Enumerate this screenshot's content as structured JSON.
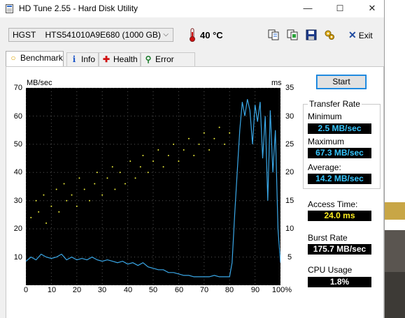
{
  "window": {
    "title": "HD Tune 2.55 - Hard Disk Utility",
    "min_glyph": "—",
    "max_glyph": "☐",
    "close_glyph": "✕"
  },
  "toolbar": {
    "drive": "HGST    HTS541010A9E680 (1000 GB)",
    "temperature": "40 °C",
    "exit_label": "Exit"
  },
  "tabs": [
    {
      "label": "Benchmark",
      "icon": "lightbulb-icon"
    },
    {
      "label": "Info",
      "icon": "info-icon"
    },
    {
      "label": "Health",
      "icon": "health-cross-icon"
    },
    {
      "label": "Error Scan",
      "icon": "magnifier-icon"
    }
  ],
  "chart": {
    "left_unit": "MB/sec",
    "right_unit": "ms",
    "left_ticks": [
      "70",
      "60",
      "50",
      "40",
      "30",
      "20",
      "10"
    ],
    "right_ticks": [
      "35",
      "30",
      "25",
      "20",
      "15",
      "10",
      "5"
    ],
    "x_ticks": [
      "0",
      "10",
      "20",
      "30",
      "40",
      "50",
      "60",
      "70",
      "80",
      "90",
      "100%"
    ]
  },
  "chart_data": {
    "type": "line",
    "xlabel": "",
    "ylabel": "MB/sec",
    "y2label": "ms",
    "xlim": [
      0,
      100
    ],
    "ylim": [
      0,
      70
    ],
    "y2lim": [
      0,
      35
    ],
    "grid": true,
    "series": [
      {
        "axis": "left",
        "color": "#3aa8e8",
        "x": [
          0,
          2,
          4,
          6,
          8,
          10,
          12,
          14,
          16,
          18,
          20,
          22,
          24,
          26,
          28,
          30,
          32,
          34,
          36,
          38,
          40,
          42,
          44,
          46,
          48,
          50,
          52,
          54,
          56,
          58,
          60,
          62,
          64,
          66,
          68,
          70,
          72,
          74,
          76,
          78,
          80,
          81,
          82,
          83,
          84,
          85,
          86,
          87,
          88,
          89,
          90,
          91,
          92,
          93,
          94,
          95,
          96,
          97,
          98,
          99,
          100
        ],
        "y": [
          8.5,
          10,
          9,
          11,
          10,
          9.5,
          10,
          11,
          9,
          10,
          9,
          9.5,
          9,
          10,
          9,
          8.5,
          9,
          8.5,
          8,
          8.5,
          7.5,
          8,
          7,
          8,
          6.5,
          6,
          5.5,
          5.5,
          4.5,
          4.5,
          4,
          3.5,
          3.5,
          3,
          3,
          3,
          3,
          3.5,
          3,
          3,
          3,
          8,
          25,
          40,
          55,
          65,
          60,
          66,
          62,
          50,
          64,
          58,
          65,
          45,
          60,
          30,
          62,
          40,
          55,
          20,
          8
        ]
      },
      {
        "axis": "right",
        "type": "scatter",
        "color": "#e8e83a",
        "x": [
          2,
          4,
          5,
          7,
          8,
          10,
          12,
          13,
          15,
          16,
          18,
          20,
          21,
          23,
          25,
          27,
          28,
          30,
          32,
          34,
          35,
          37,
          39,
          41,
          43,
          45,
          46,
          48,
          50,
          52,
          54,
          56,
          58,
          60,
          62,
          64,
          66,
          68,
          70,
          72,
          74,
          76,
          78,
          80
        ],
        "y": [
          12,
          15,
          13,
          16,
          11,
          14,
          17,
          13,
          18,
          15,
          16,
          14,
          19,
          17,
          15,
          18,
          20,
          16,
          19,
          21,
          17,
          20,
          18,
          22,
          19,
          21,
          23,
          20,
          22,
          24,
          21,
          23,
          25,
          22,
          24,
          26,
          23,
          25,
          27,
          24,
          26,
          28,
          25,
          27
        ]
      }
    ]
  },
  "controls": {
    "start_label": "Start"
  },
  "stats": {
    "transfer_title": "Transfer Rate",
    "min_label": "Minimum",
    "min_value": "2.5 MB/sec",
    "max_label": "Maximum",
    "max_value": "67.3 MB/sec",
    "avg_label": "Average:",
    "avg_value": "14.2 MB/sec",
    "access_label": "Access Time:",
    "access_value": "24.0 ms",
    "burst_label": "Burst Rate",
    "burst_value": "175.7 MB/sec",
    "cpu_label": "CPU Usage",
    "cpu_value": "1.8%"
  }
}
